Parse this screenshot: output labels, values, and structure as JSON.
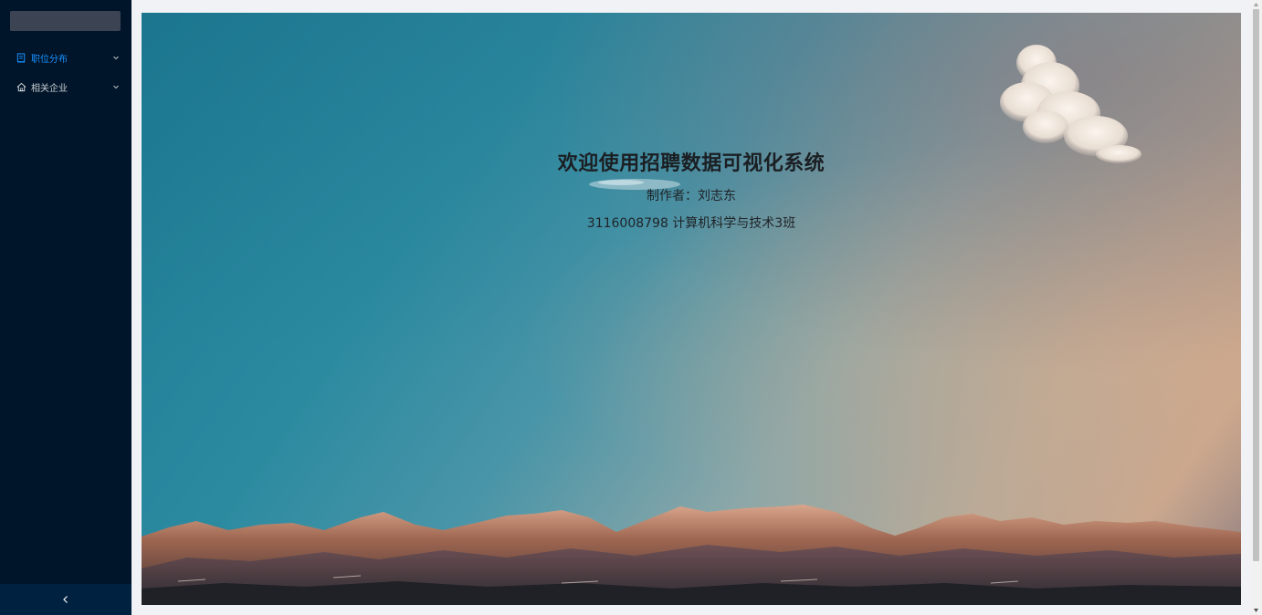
{
  "sidebar": {
    "menu": [
      {
        "label": "职位分布",
        "icon": "briefcase-icon",
        "active": true
      },
      {
        "label": "相关企业",
        "icon": "home-icon",
        "active": false
      }
    ],
    "collapse_icon": "chevron-left-icon"
  },
  "main": {
    "title": "欢迎使用招聘数据可视化系统",
    "author": "制作者：刘志东",
    "class_info": "3116008798 计算机科学与技术3班"
  },
  "colors": {
    "sidebar_bg": "#001529",
    "active_accent": "#1890ff"
  }
}
